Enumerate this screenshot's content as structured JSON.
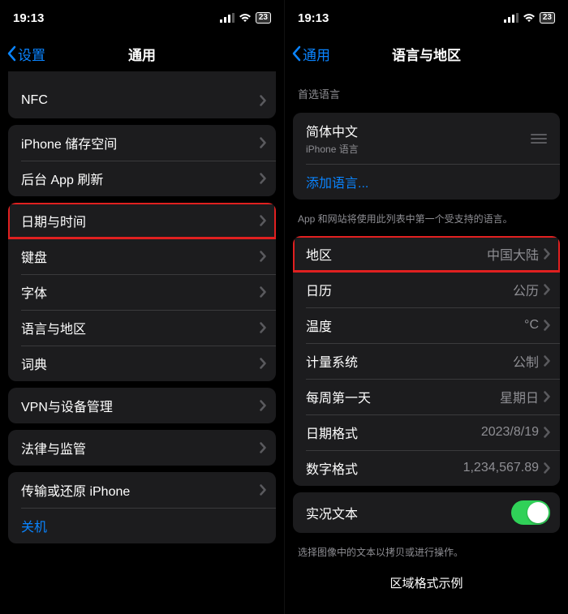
{
  "status": {
    "time": "19:13",
    "battery": "23"
  },
  "left": {
    "back_label": "设置",
    "title": "通用",
    "groups": [
      {
        "top_cut": true,
        "rows": [
          {
            "label": "NFC",
            "chevron": true
          }
        ]
      },
      {
        "rows": [
          {
            "label": "iPhone 储存空间",
            "chevron": true
          },
          {
            "label": "后台 App 刷新",
            "chevron": true
          }
        ]
      },
      {
        "rows": [
          {
            "label": "日期与时间",
            "chevron": true,
            "highlighted": true
          },
          {
            "label": "键盘",
            "chevron": true
          },
          {
            "label": "字体",
            "chevron": true
          },
          {
            "label": "语言与地区",
            "chevron": true
          },
          {
            "label": "词典",
            "chevron": true
          }
        ]
      },
      {
        "rows": [
          {
            "label": "VPN与设备管理",
            "chevron": true
          }
        ]
      },
      {
        "rows": [
          {
            "label": "法律与监管",
            "chevron": true
          }
        ]
      },
      {
        "rows": [
          {
            "label": "传输或还原 iPhone",
            "chevron": true
          },
          {
            "label": "关机",
            "link": true
          }
        ]
      }
    ]
  },
  "right": {
    "back_label": "通用",
    "title": "语言与地区",
    "lang_header": "首选语言",
    "lang_row": {
      "label": "简体中文",
      "sublabel": "iPhone 语言"
    },
    "add_lang": "添加语言...",
    "lang_footer": "App 和网站将使用此列表中第一个受支持的语言。",
    "region_rows": [
      {
        "label": "地区",
        "value": "中国大陆",
        "highlighted": true
      },
      {
        "label": "日历",
        "value": "公历"
      },
      {
        "label": "温度",
        "value": "°C"
      },
      {
        "label": "计量系统",
        "value": "公制"
      },
      {
        "label": "每周第一天",
        "value": "星期日"
      },
      {
        "label": "日期格式",
        "value": "2023/8/19"
      },
      {
        "label": "数字格式",
        "value": "1,234,567.89"
      }
    ],
    "live_text": {
      "label": "实况文本"
    },
    "live_text_footer": "选择图像中的文本以拷贝或进行操作。",
    "format_example_title": "区域格式示例"
  }
}
